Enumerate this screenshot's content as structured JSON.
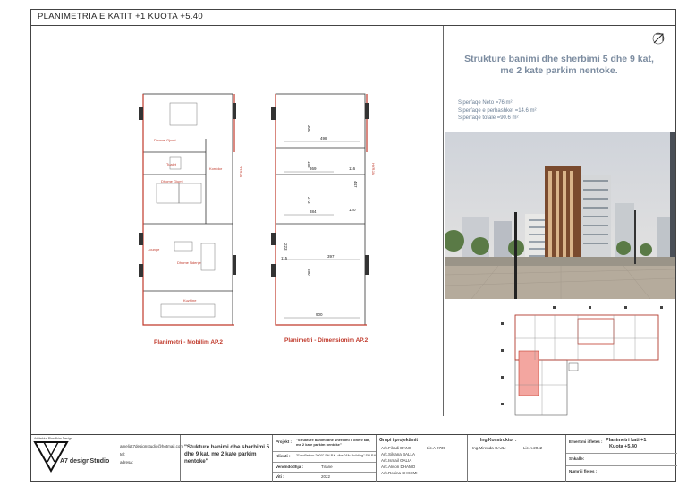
{
  "sheet_title": "PLANIMETRIA E KATIT +1  KUOTA +5.40",
  "project": {
    "title_line1": "Strukture  banimi dhe sherbimi 5 dhe 9 kat,",
    "title_line2": "me 2 kate parkim nentoke."
  },
  "surfaces": {
    "neto": "Siperfaqe Neto =76 m²",
    "shared": "Siperfaqe e perbashket =14.6 m²",
    "total": "Siperfaqe totale =90.6 m²"
  },
  "plan_furniture": {
    "caption": "Planimetri - Mobilim AP.2",
    "rooms": [
      "Dhome Gjumi",
      "Tualet",
      "Korridor",
      "Dhome Gjumi",
      "Lounge",
      "Dhome Ndenje",
      "Kuzhine"
    ],
    "entry_label": "HYRJA"
  },
  "plan_dimensions": {
    "caption": "Planimetri - Dimensionim AP.2",
    "dims": [
      "300",
      "498",
      "155",
      "369",
      "116",
      "273",
      "384",
      "120",
      "447",
      "223",
      "115",
      "397",
      "590",
      "900"
    ],
    "entry_label": "HYRJA"
  },
  "footer": {
    "logo_text": "A7 designStudio",
    "logo_small": "Arkitektur Planifikim Design",
    "email": "ameliat7designstudio@hotmail.com",
    "tel_label": "tel:",
    "web_label": "adresa:",
    "project_quote": "\"Stukture banimi dhe sherbimi 5 dhe 9 kat, me 2 kate parkim nentoke\"",
    "projekt_label": "Projekt :",
    "projekt_value": "\"Strukture banimi dhe sherbimi 5 dhe 9 kat, me 2 kate parkim nentoke\"",
    "klienti_label": "Klienti :",
    "klienti_value": "\"EuroBetton 2000\" SH.P.K. dhe \"Alb Building\" SH.P.K",
    "vendndodhja_label": "Vendndodhja :",
    "vendndodhja_value": "Tirane",
    "viti_label": "Viti :",
    "viti_value": "2022",
    "grupi_label": "Grupi i projektimit :",
    "team": [
      {
        "name": "Ark.Fikadi DANO",
        "lic": "Lic.A 2739"
      },
      {
        "name": "Ark.Silvana BALLA",
        "lic": ""
      },
      {
        "name": "Ark.Ismail GALIA",
        "lic": ""
      },
      {
        "name": "Ark.Alison DHAMO",
        "lic": ""
      },
      {
        "name": "Ark.Rosina SHKEMI",
        "lic": ""
      }
    ],
    "ing_label": "Ing.Konstruktor :",
    "ing_name": "Ing.Mirenda GAJLI",
    "ing_lic": "Lic.K.2042",
    "emertimi_label": "Emertimi i fletes :",
    "emertimi_value": "Planimetri kati +1",
    "emertimi_value2": "Kuota +5.40",
    "shkalla_label": "Shkalle:",
    "numri_label": "Numri i fletes :"
  }
}
